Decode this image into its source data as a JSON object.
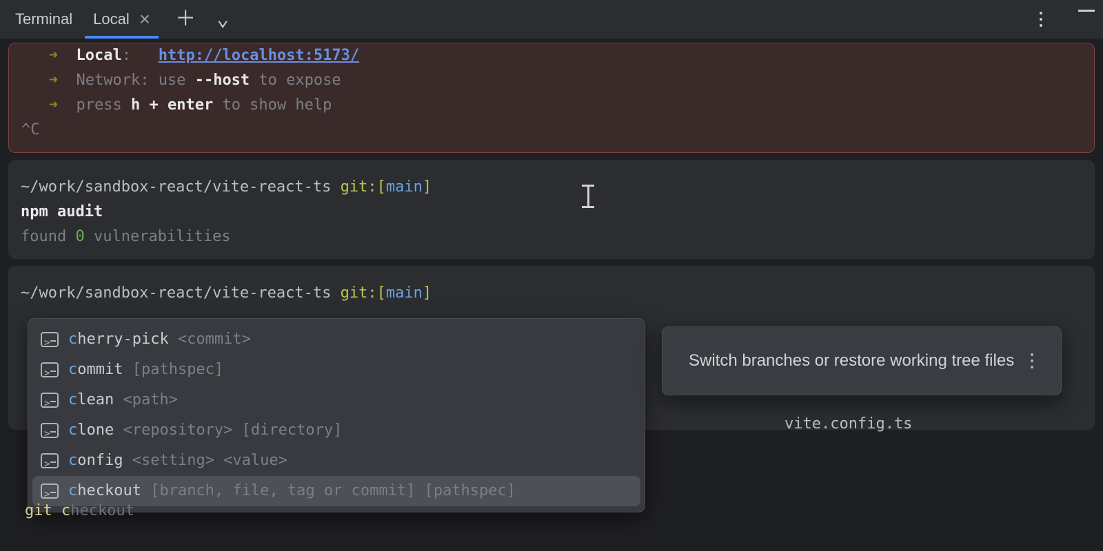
{
  "tabbar": {
    "title": "Terminal",
    "tab_label": "Local",
    "close_glyph": "×",
    "plus_glyph": "＋",
    "chevron_glyph": "⌄"
  },
  "vite": {
    "arrow": "➜",
    "local_label": "Local",
    "local_colon": ":",
    "local_url": "http://localhost:5173/",
    "network_label": "Network",
    "network_pre": ": use ",
    "network_flag": "--host",
    "network_post": " to expose",
    "help_pre": "press ",
    "help_key": "h + enter",
    "help_post": " to show help",
    "ctrlc": "^C"
  },
  "block2": {
    "path": "~/work/sandbox-react/vite-react-ts",
    "git_label": " git:",
    "branch_open": "[",
    "branch": "main",
    "branch_close": "]",
    "command": "npm audit",
    "result_pre": "found ",
    "result_num": "0",
    "result_post": " vulnerabilities"
  },
  "block3": {
    "path": "~/work/sandbox-react/vite-react-ts",
    "git_label": " git:",
    "branch_open": "[",
    "branch": "main",
    "branch_close": "]"
  },
  "autocomplete": {
    "items": [
      {
        "hi": "c",
        "rest": "herry-pick",
        "args": " <commit>",
        "selected": false
      },
      {
        "hi": "c",
        "rest": "ommit",
        "args": " [pathspec]",
        "selected": false
      },
      {
        "hi": "c",
        "rest": "lean",
        "args": " <path>",
        "selected": false
      },
      {
        "hi": "c",
        "rest": "lone",
        "args": " <repository> [directory]",
        "selected": false
      },
      {
        "hi": "c",
        "rest": "onfig",
        "args": " <setting> <value>",
        "selected": false
      },
      {
        "hi": "c",
        "rest": "heckout",
        "args": " [branch, file, tag or commit] [pathspec]",
        "selected": true
      }
    ]
  },
  "tooltip": {
    "text": "Switch branches or restore working tree files"
  },
  "visible_file": "vite.config.ts",
  "input": {
    "typed": "git c",
    "ghost": "heckout"
  }
}
